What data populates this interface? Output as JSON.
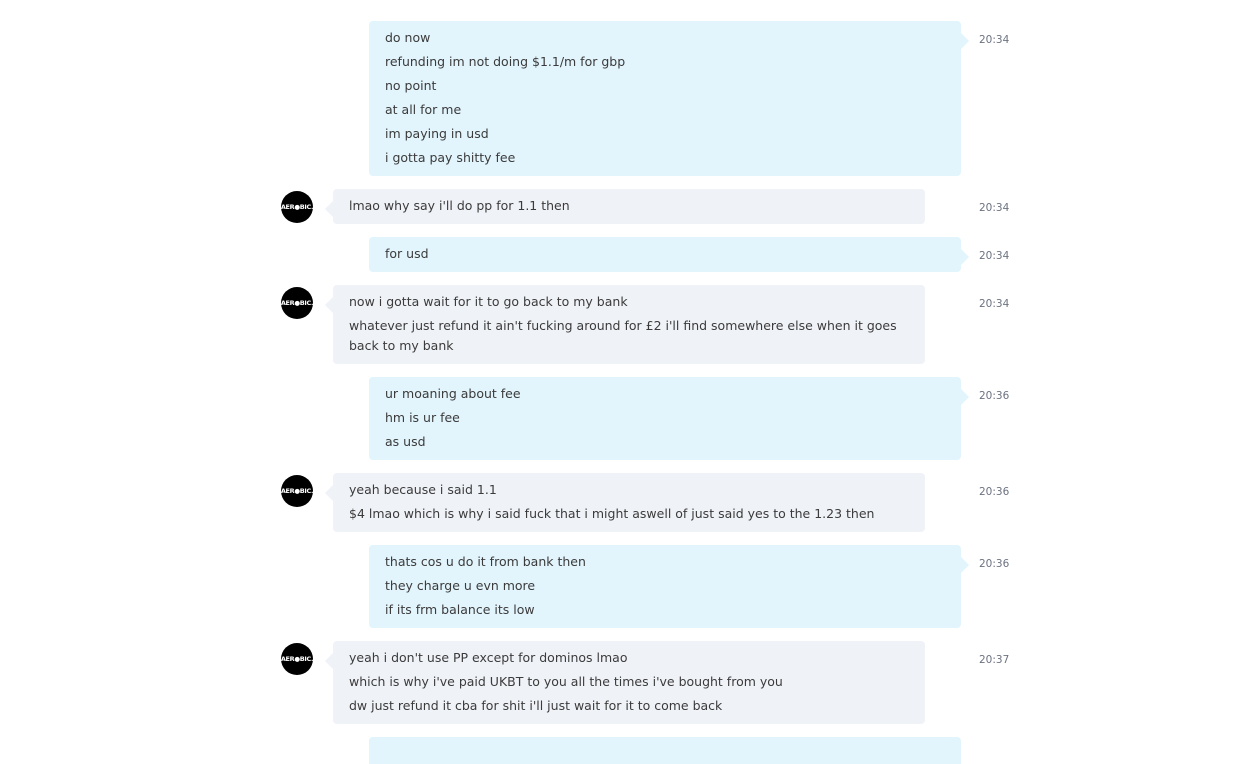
{
  "avatar_label": "AER●BIC.",
  "messages": [
    {
      "direction": "out",
      "time": "20:34",
      "lines": [
        "do now",
        "refunding im not doing $1.1/m for gbp",
        "no point",
        "at all for me",
        "im paying in usd",
        "i gotta pay shitty fee"
      ]
    },
    {
      "direction": "in",
      "time": "20:34",
      "lines": [
        "lmao why say i'll do pp for 1.1 then"
      ]
    },
    {
      "direction": "out",
      "time": "20:34",
      "lines": [
        "for usd"
      ]
    },
    {
      "direction": "in",
      "time": "20:34",
      "lines": [
        "now i gotta wait for it to go back to my bank",
        "whatever just refund it ain't fucking around for £2 i'll find somewhere else when it goes back to my bank"
      ]
    },
    {
      "direction": "out",
      "time": "20:36",
      "lines": [
        "ur moaning about fee",
        "hm is ur fee",
        "as usd"
      ]
    },
    {
      "direction": "in",
      "time": "20:36",
      "lines": [
        "yeah because i said 1.1",
        "$4 lmao which is why i said fuck that i might aswell of just said yes to the 1.23 then"
      ]
    },
    {
      "direction": "out",
      "time": "20:36",
      "lines": [
        "thats cos u do it from bank then",
        "they charge u evn more",
        "if its frm balance its low"
      ]
    },
    {
      "direction": "in",
      "time": "20:37",
      "lines": [
        "yeah i don't use PP except for dominos lmao",
        "which is why i've paid UKBT to you all the times i've bought from you",
        "dw just refund it cba for shit i'll just wait for it to come back"
      ]
    }
  ]
}
